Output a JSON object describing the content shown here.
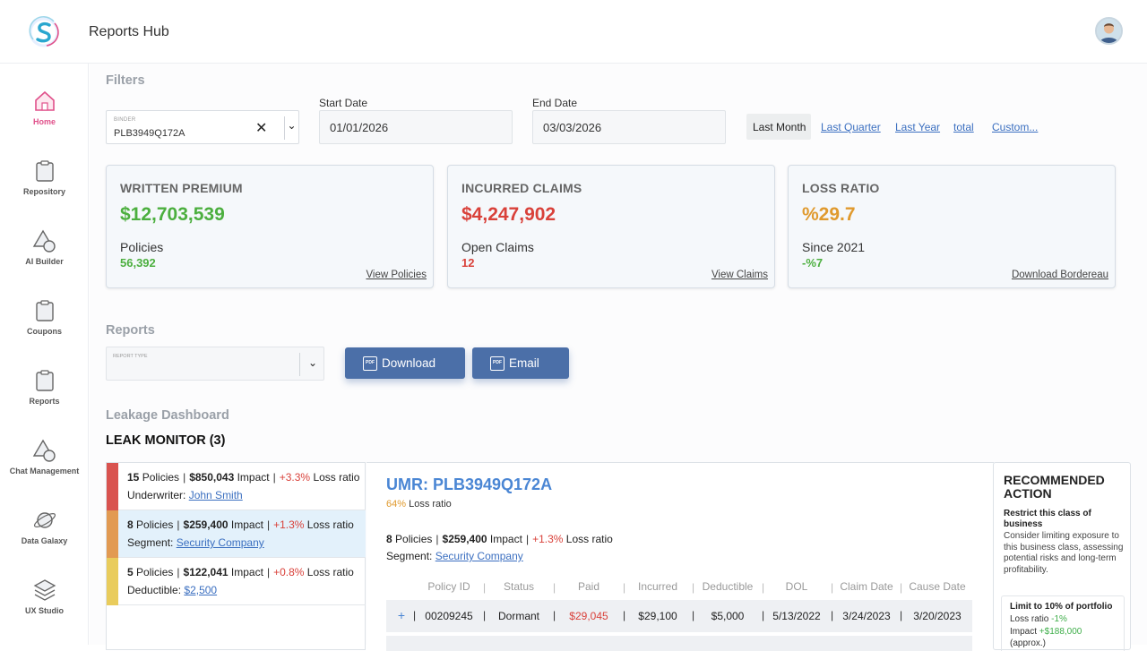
{
  "app": {
    "title": "Reports Hub"
  },
  "sidebar": {
    "items": [
      {
        "label": "Home",
        "icon": "home-icon",
        "active": true
      },
      {
        "label": "Repository",
        "icon": "clipboard-icon"
      },
      {
        "label": "AI Builder",
        "icon": "shapes-icon"
      },
      {
        "label": "Coupons",
        "icon": "clipboard-icon"
      },
      {
        "label": "Reports",
        "icon": "clipboard-icon"
      },
      {
        "label": "Chat Management",
        "icon": "shapes-icon"
      },
      {
        "label": "Data Galaxy",
        "icon": "planet-icon"
      },
      {
        "label": "UX Studio",
        "icon": "layers-icon"
      }
    ]
  },
  "filters": {
    "title": "Filters",
    "binder_label": "BINDER",
    "binder_value": "PLB3949Q172A",
    "start_label": "Start Date",
    "start_value": "01/01/2026",
    "end_label": "End Date",
    "end_value": "03/03/2026",
    "ranges": [
      "Last Month",
      "Last Quarter",
      "Last Year",
      "total",
      "Custom..."
    ]
  },
  "cards": [
    {
      "title": "WRITTEN PREMIUM",
      "value": "$12,703,539",
      "value_color": "#4caf3f",
      "sub": "Policies",
      "subval": "56,392",
      "subval_color": "#4caf3f",
      "link": "View Policies"
    },
    {
      "title": "INCURRED CLAIMS",
      "value": "$4,247,902",
      "value_color": "#d9413a",
      "sub": "Open Claims",
      "subval": "12",
      "subval_color": "#d9413a",
      "link": "View Claims"
    },
    {
      "title": "LOSS RATIO",
      "value": "%29.7",
      "value_color": "#e09a2e",
      "sub": "Since 2021",
      "subval": "-%7",
      "subval_color": "#4caf3f",
      "link": "Download Bordereau"
    }
  ],
  "reports": {
    "title": "Reports",
    "type_label": "REPORT TYPE",
    "download_label": "Download",
    "email_label": "Email"
  },
  "leakage": {
    "title": "Leakage Dashboard",
    "monitor_title": "LEAK MONITOR (3)",
    "rows": [
      {
        "policies": "15",
        "impact": "$850,043",
        "ratio": "+3.3%",
        "meta_label": "Underwriter:",
        "meta_value": "John Smith",
        "color": "#d9534f"
      },
      {
        "policies": "8",
        "impact": "$259,400",
        "ratio": "+1.3%",
        "meta_label": "Segment:",
        "meta_value": "Security Company",
        "color": "#e29a52"
      },
      {
        "policies": "5",
        "impact": "$122,041",
        "ratio": "+0.8%",
        "meta_label": "Deductible:",
        "meta_value": "$2,500",
        "color": "#e9cc5c"
      }
    ],
    "word_policies": "Policies",
    "word_impact": "Impact",
    "word_loss_ratio": "Loss ratio"
  },
  "detail": {
    "umr": "UMR: PLB3949Q172A",
    "ratio_value": "64%",
    "ratio_label": "Loss ratio",
    "policies": "8",
    "impact": "$259,400",
    "change": "+1.3%",
    "segment_label": "Segment:",
    "segment_value": "Security Company",
    "columns": [
      "Policy ID",
      "Status",
      "Paid",
      "Incurred",
      "Deductible",
      "DOL",
      "Claim Date",
      "Cause Date"
    ],
    "row": {
      "expand": "+",
      "policy_id": "00209245",
      "status": "Dormant",
      "paid": "$29,045",
      "incurred": "$29,100",
      "deductible": "$5,000",
      "dol": "5/13/2022",
      "claim_date": "3/24/2023",
      "cause_date": "3/20/2023"
    }
  },
  "recommended": {
    "title": "RECOMMENDED ACTION",
    "headline": "Restrict this class of business",
    "body": "Consider limiting exposure to this business class, assessing potential risks and long-term profitability.",
    "box_title": "Limit to 10% of portfolio",
    "box_ratio_label": "Loss ratio",
    "box_ratio_value": "-1%",
    "box_impact_label": "Impact",
    "box_impact_value": "+$188,000",
    "box_note": "(approx.)"
  }
}
